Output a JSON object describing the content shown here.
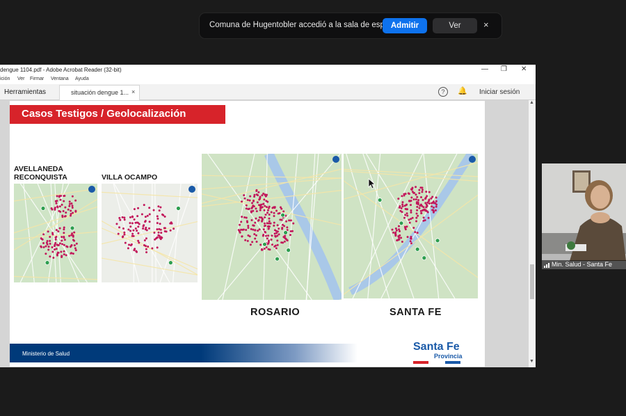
{
  "notification": {
    "text": "Comuna de Hugentobler accedió a la sala de espera",
    "admit_label": "Admitir",
    "view_label": "Ver",
    "close_symbol": "×"
  },
  "acrobat": {
    "title": "dengue 1104.pdf - Adobe Acrobat Reader (32-bit)",
    "menu": [
      "ición",
      "Ver",
      "Firmar",
      "Ventana",
      "Ayuda"
    ],
    "tools_tab": "Herramientas",
    "doc_tab": "situación dengue 1...",
    "doc_tab_close": "×",
    "help_symbol": "?",
    "signin": "Iniciar sesión"
  },
  "slide": {
    "title": "Casos Testigos / Geolocalización",
    "labels": {
      "avellaneda": "AVELLANEDA",
      "reconquista": "RECONQUISTA",
      "villa_ocampo": "VILLA OCAMPO",
      "rosario": "ROSARIO",
      "santa_fe": "SANTA FE"
    },
    "footer": "Ministerio de Salud",
    "brand_main": "Santa Fe",
    "brand_sub": "Provincia"
  },
  "participant": {
    "name": "Min. Salud - Santa Fe"
  },
  "colors": {
    "banner_red": "#d7232a",
    "zoom_blue": "#0e72ed",
    "brand_blue": "#1a5aa8",
    "case_dot": "#c2185b"
  },
  "icons": [
    "close-icon",
    "help-icon",
    "bell-icon",
    "chevron-up-icon",
    "chevron-down-icon",
    "signal-icon",
    "mouse-pointer-icon"
  ]
}
